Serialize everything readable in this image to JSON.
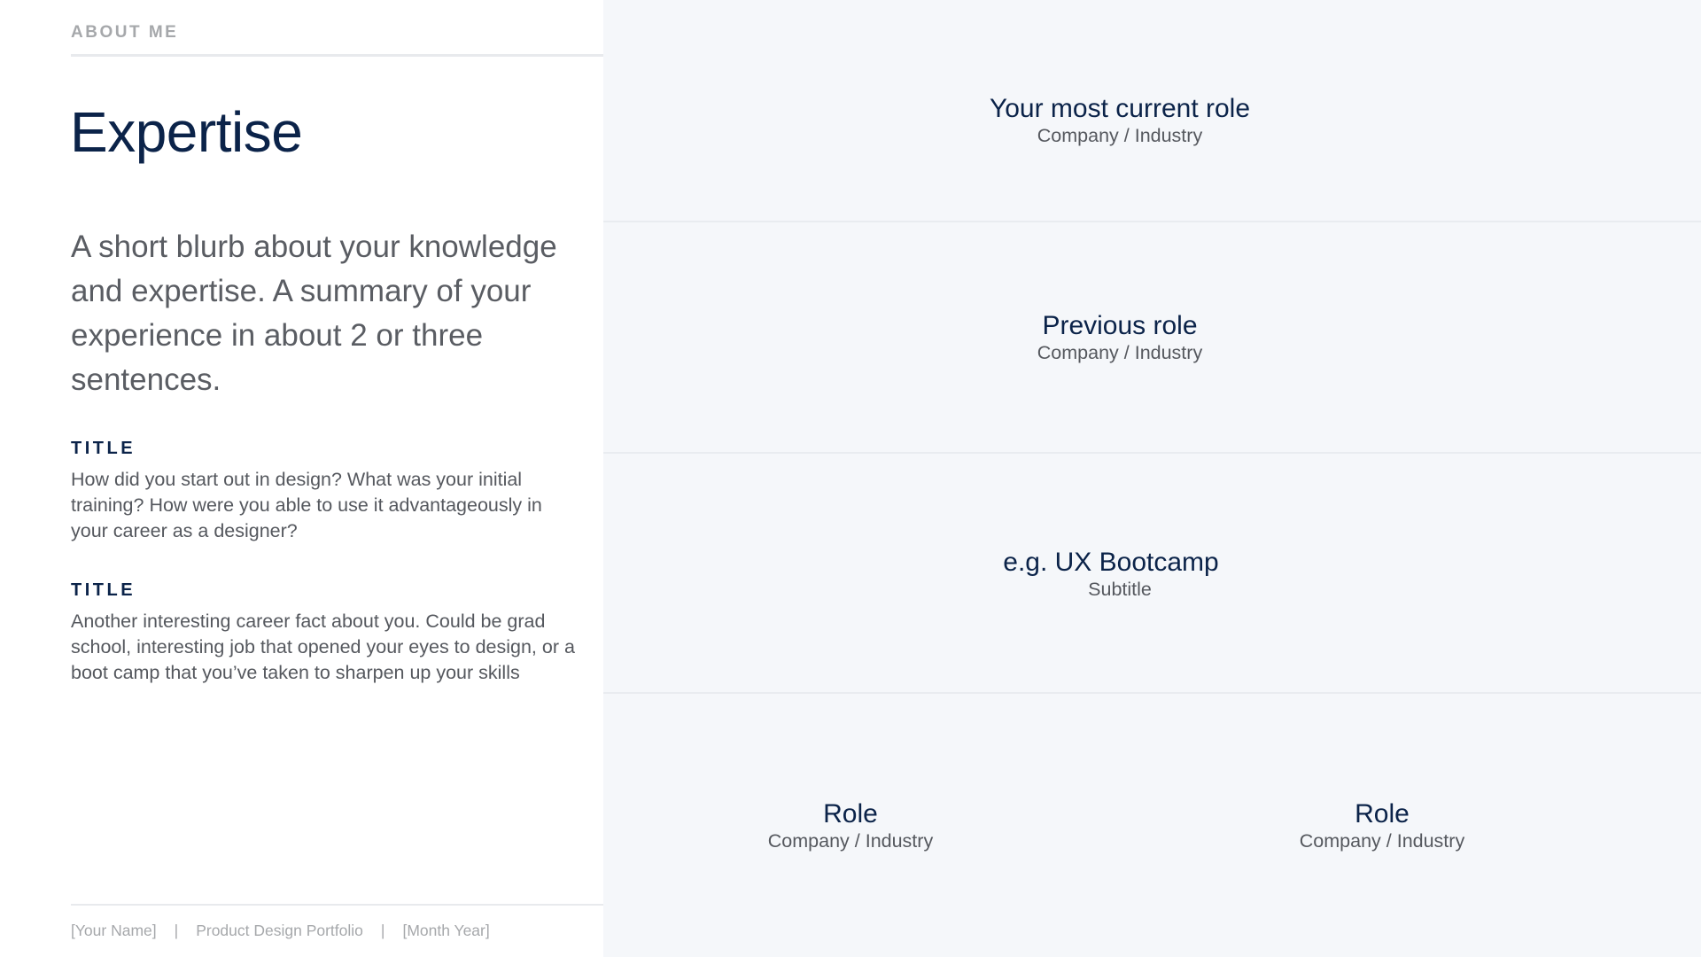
{
  "left": {
    "section_label": "ABOUT ME",
    "title": "Expertise",
    "blurb": "A short blurb about your knowledge and expertise. A summary of your experience in about 2 or three sentences.",
    "facts": [
      {
        "title": "TITLE",
        "body": "How did you start out in design? What was your initial training? How were you able to use it advantageously in your career as a designer?"
      },
      {
        "title": "TITLE",
        "body": "Another interesting career fact about you. Could be grad school, interesting job that opened your eyes to design, or a boot camp that you’ve taken to sharpen up your skills"
      }
    ],
    "footer": {
      "name": "[Your Name]",
      "separator": "|",
      "portfolio": "Product Design Portfolio",
      "date": "[Month Year]"
    }
  },
  "roles": {
    "current": {
      "title": "Your most current role",
      "subtitle": "Company / Industry"
    },
    "previous": {
      "title": "Previous role",
      "subtitle": "Company / Industry"
    },
    "education": {
      "title": "e.g. UX Bootcamp",
      "subtitle": "Subtitle"
    },
    "other": [
      {
        "title": "Role",
        "subtitle": "Company / Industry"
      },
      {
        "title": "Role",
        "subtitle": "Company / Industry"
      }
    ]
  },
  "colors": {
    "navy": "#0b2349",
    "body_text": "#55585e",
    "muted": "#a6a8ab",
    "right_panel_bg": "#f5f7fa"
  }
}
